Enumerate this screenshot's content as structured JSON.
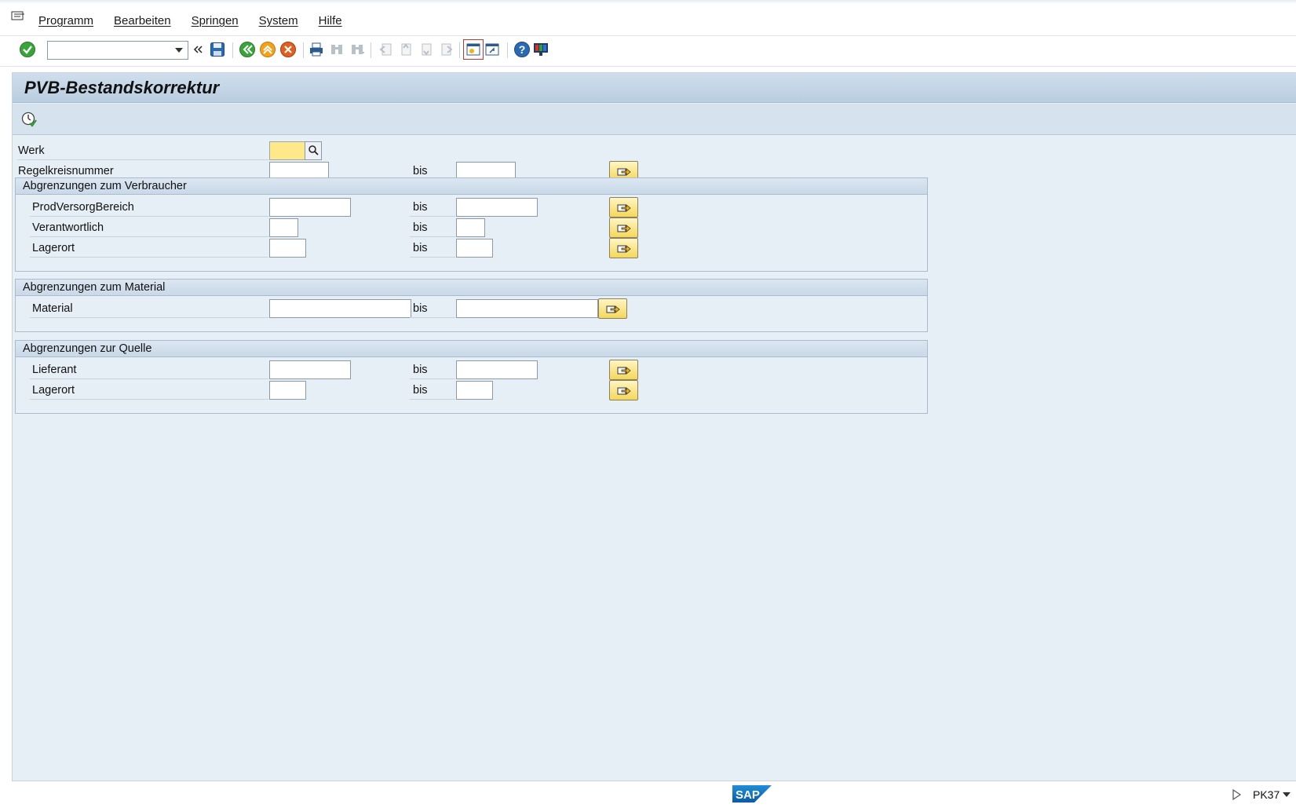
{
  "menu": {
    "items": [
      "Programm",
      "Bearbeiten",
      "Springen",
      "System",
      "Hilfe"
    ]
  },
  "toolbar": {
    "command_field_value": ""
  },
  "screen": {
    "title": "PVB-Bestandskorrektur"
  },
  "fields": {
    "werk_label": "Werk",
    "werk_value": "",
    "regelkreis_label": "Regelkreisnummer",
    "bis": "bis"
  },
  "groups": {
    "verbraucher": {
      "title": "Abgrenzungen zum Verbraucher",
      "rows": [
        "ProdVersorgBereich",
        "Verantwortlich",
        "Lagerort"
      ]
    },
    "material": {
      "title": "Abgrenzungen zum Material",
      "rows": [
        "Material"
      ]
    },
    "quelle": {
      "title": "Abgrenzungen zur Quelle",
      "rows": [
        "Lieferant",
        "Lagerort"
      ]
    }
  },
  "status": {
    "transaction": "PK37",
    "logo": "SAP"
  },
  "colors": {
    "required_field": "#fde98a",
    "background": "#e6eef6",
    "title_bar": "#c4d6e8",
    "multi_button": "#f4d75a"
  },
  "icons": [
    "menu-icon",
    "enter-check-icon",
    "back-icon",
    "save-icon",
    "nav-back-icon",
    "exit-icon",
    "cancel-icon",
    "print-icon",
    "find-icon",
    "find-next-icon",
    "first-page-icon",
    "previous-page-icon",
    "next-page-icon",
    "last-page-icon",
    "new-session-icon",
    "shortcut-icon",
    "help-icon",
    "customize-layout-icon",
    "execute-icon",
    "search-help-icon",
    "multiple-selection-icon"
  ]
}
